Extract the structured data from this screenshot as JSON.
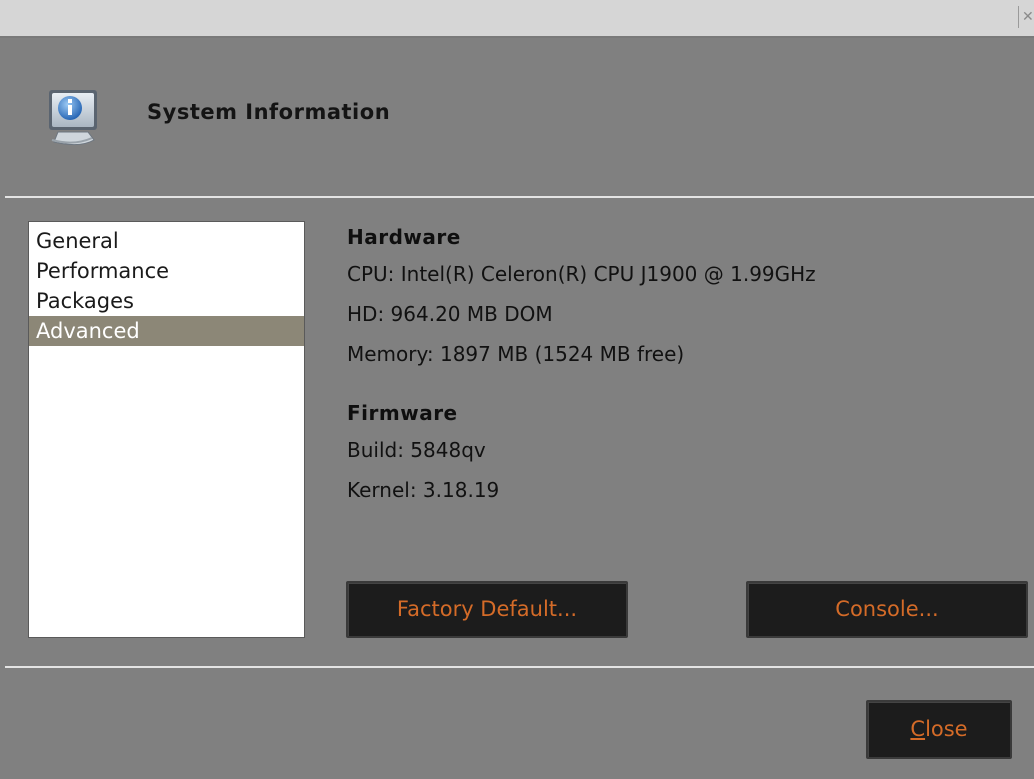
{
  "window": {
    "close_glyph": "✕"
  },
  "header": {
    "title": "System Information",
    "icon": "info-monitor-icon"
  },
  "nav": {
    "items": [
      {
        "label": "General",
        "selected": false
      },
      {
        "label": "Performance",
        "selected": false
      },
      {
        "label": "Packages",
        "selected": false
      },
      {
        "label": "Advanced",
        "selected": true
      }
    ]
  },
  "hardware": {
    "title": "Hardware",
    "cpu": "CPU: Intel(R) Celeron(R) CPU J1900 @ 1.99GHz",
    "hd": "HD: 964.20 MB DOM",
    "memory": "Memory: 1897 MB (1524 MB free)"
  },
  "firmware": {
    "title": "Firmware",
    "build": "Build: 5848qv",
    "kernel": "Kernel: 3.18.19"
  },
  "buttons": {
    "factory_default": "Factory Default...",
    "console": "Console...",
    "close_mnemonic": "C",
    "close_rest": "lose"
  },
  "colors": {
    "background": "#808080",
    "button_bg": "#1c1c1c",
    "button_text": "#d46b28",
    "selection": "#8c8777"
  }
}
